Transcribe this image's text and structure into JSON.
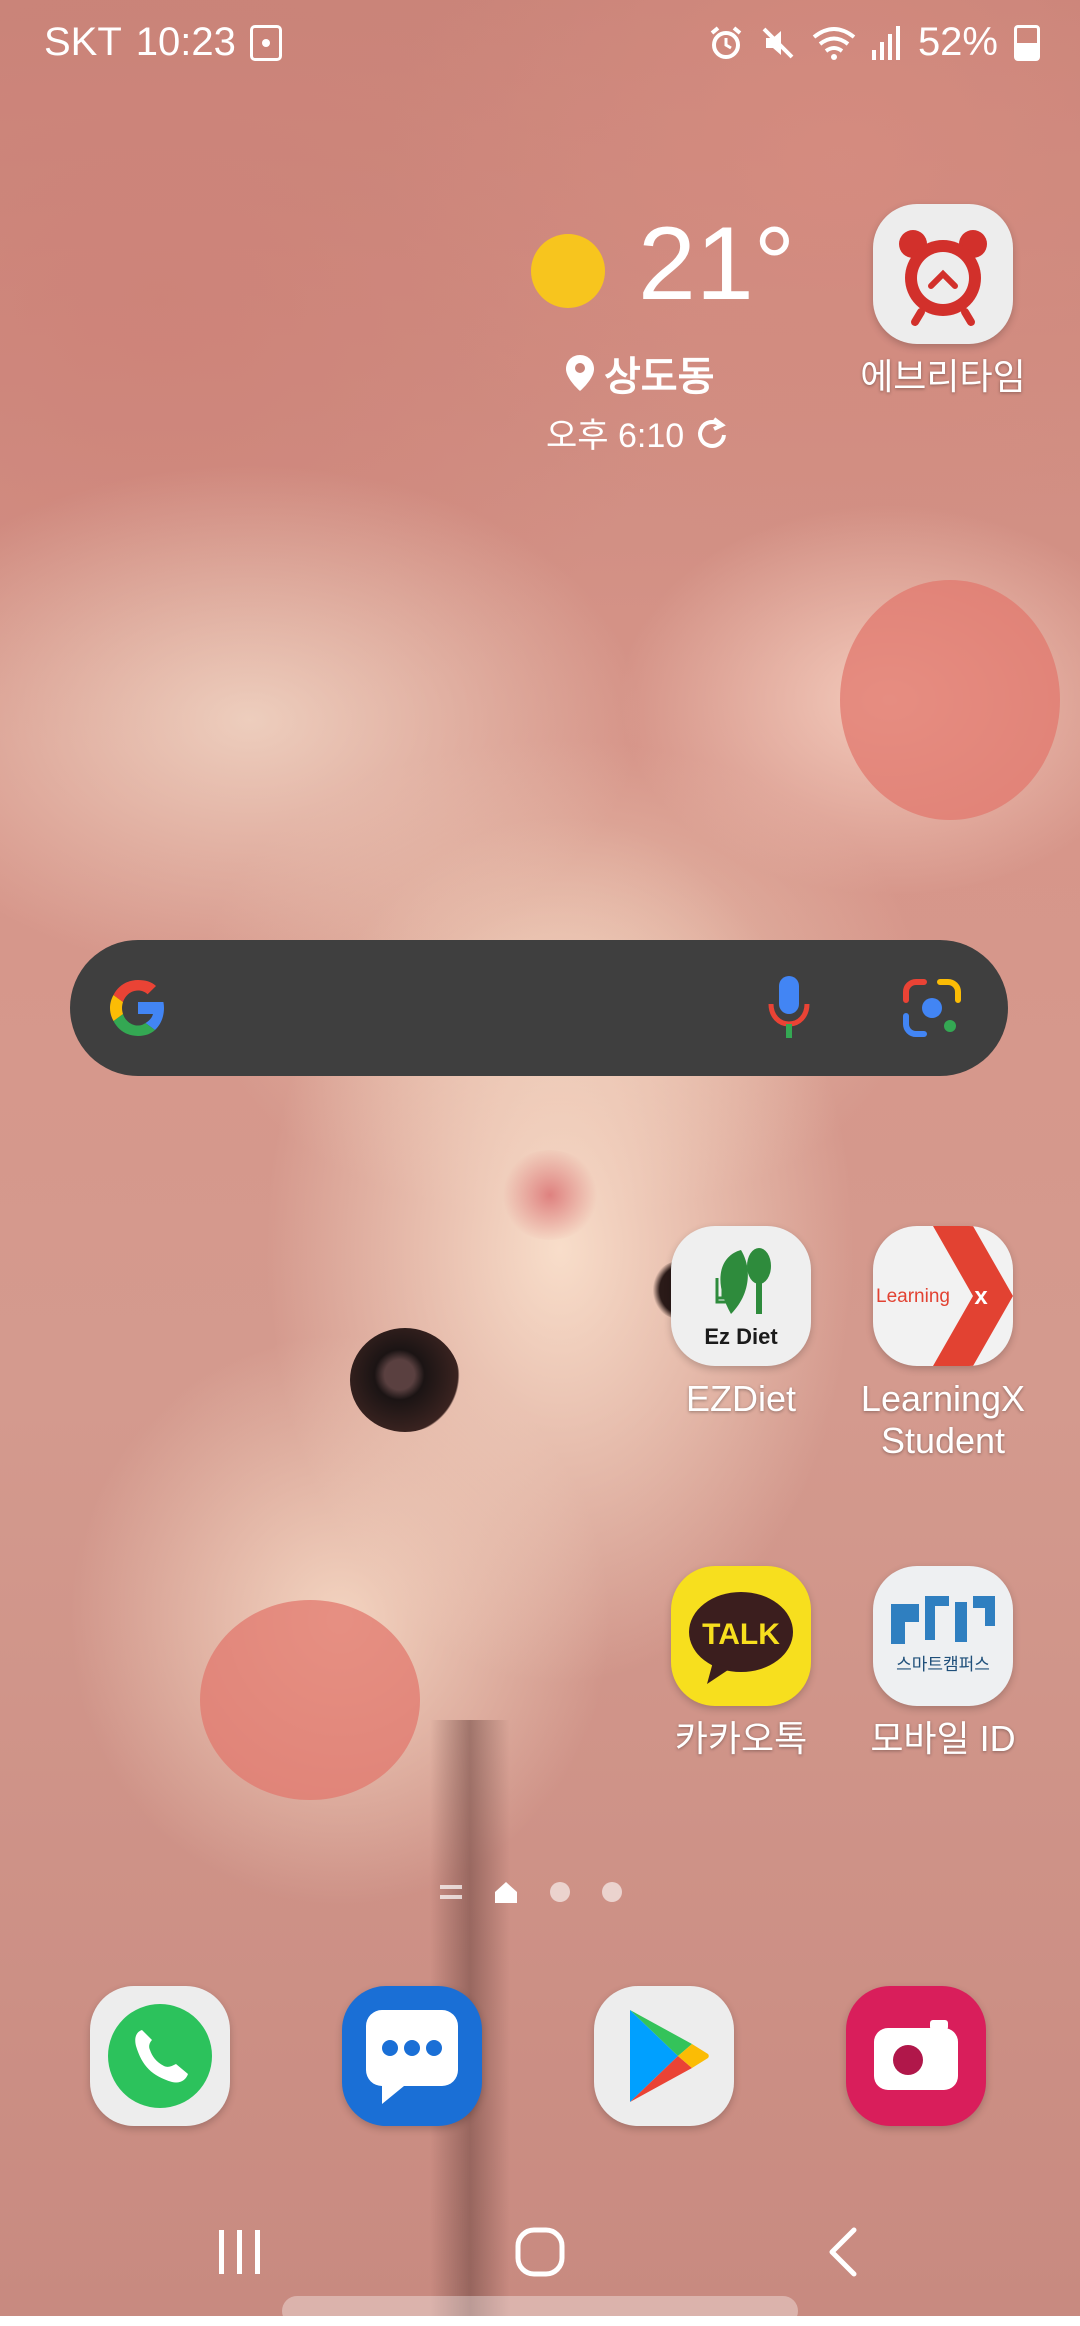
{
  "status_bar": {
    "carrier": "SKT",
    "time": "10:23",
    "battery": "52%",
    "icons": [
      "screenshot-icon",
      "alarm-icon",
      "mute-icon",
      "wifi-icon",
      "signal-icon",
      "battery-icon"
    ]
  },
  "weather": {
    "temperature": "21°",
    "location": "상도동",
    "updated": "오후 6:10",
    "icon": "sun-icon"
  },
  "apps": {
    "everytime": "에브리타임",
    "ezdiet": "EZDiet",
    "ezdiet_logo": "Ez Diet",
    "learningx_1": "LearningX",
    "learningx_2": "Student",
    "learningx_logo": "Learning",
    "kakaotalk": "카카오톡",
    "kakaotalk_logo": "TALK",
    "mobile_id": "모바일 ID",
    "mobile_id_logo": "스마트캠퍼스"
  },
  "search": {
    "icons": [
      "google-logo-icon",
      "microphone-icon",
      "google-lens-icon"
    ]
  },
  "page_indicator": {
    "pages": 4,
    "current": "home"
  },
  "dock": {
    "apps": [
      "phone-app-icon",
      "messages-app-icon",
      "play-store-app-icon",
      "camera-app-icon"
    ]
  },
  "navigation": {
    "buttons": [
      "recent-apps-icon",
      "home-icon",
      "back-icon"
    ]
  },
  "colors": {
    "sun": "#f7c51e",
    "search_bg": "#3f3f3f",
    "everytime_red": "#d2302b",
    "ezdiet_green": "#2e8b3c",
    "learningx_red": "#e24232",
    "kakao_yellow": "#f7df1e",
    "phone_green": "#2cc25c",
    "messages_blue": "#1a6fd6",
    "camera_pink": "#d91e5b"
  }
}
